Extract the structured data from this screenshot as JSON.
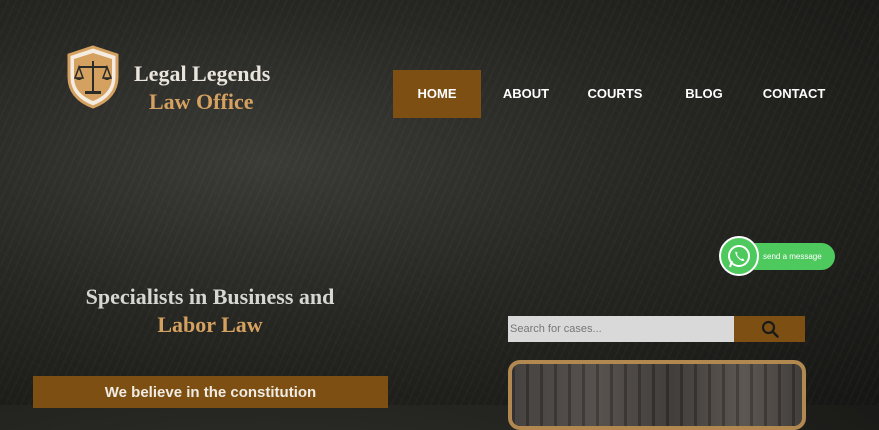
{
  "brand": {
    "name_line1": "Legal Legends",
    "name_line2": "Law Office",
    "logo_icon": "scales-of-justice-shield-icon"
  },
  "nav": {
    "items": [
      {
        "label": "HOME",
        "active": true
      },
      {
        "label": "ABOUT",
        "active": false
      },
      {
        "label": "COURTS",
        "active": false
      },
      {
        "label": "BLOG",
        "active": false
      },
      {
        "label": "CONTACT",
        "active": false
      }
    ]
  },
  "hero": {
    "title_line1": "Specialists in Business and",
    "title_line2": "Labor Law",
    "banner": "We believe in the constitution"
  },
  "search": {
    "placeholder": "Search for cases...",
    "button_icon": "search-icon"
  },
  "whatsapp": {
    "label": "send a message",
    "icon": "whatsapp-icon"
  },
  "colors": {
    "accent_brown": "#7d4f12",
    "gold_text": "#d5a160",
    "whatsapp_green": "#4ec95e",
    "background_dark": "#262622"
  }
}
